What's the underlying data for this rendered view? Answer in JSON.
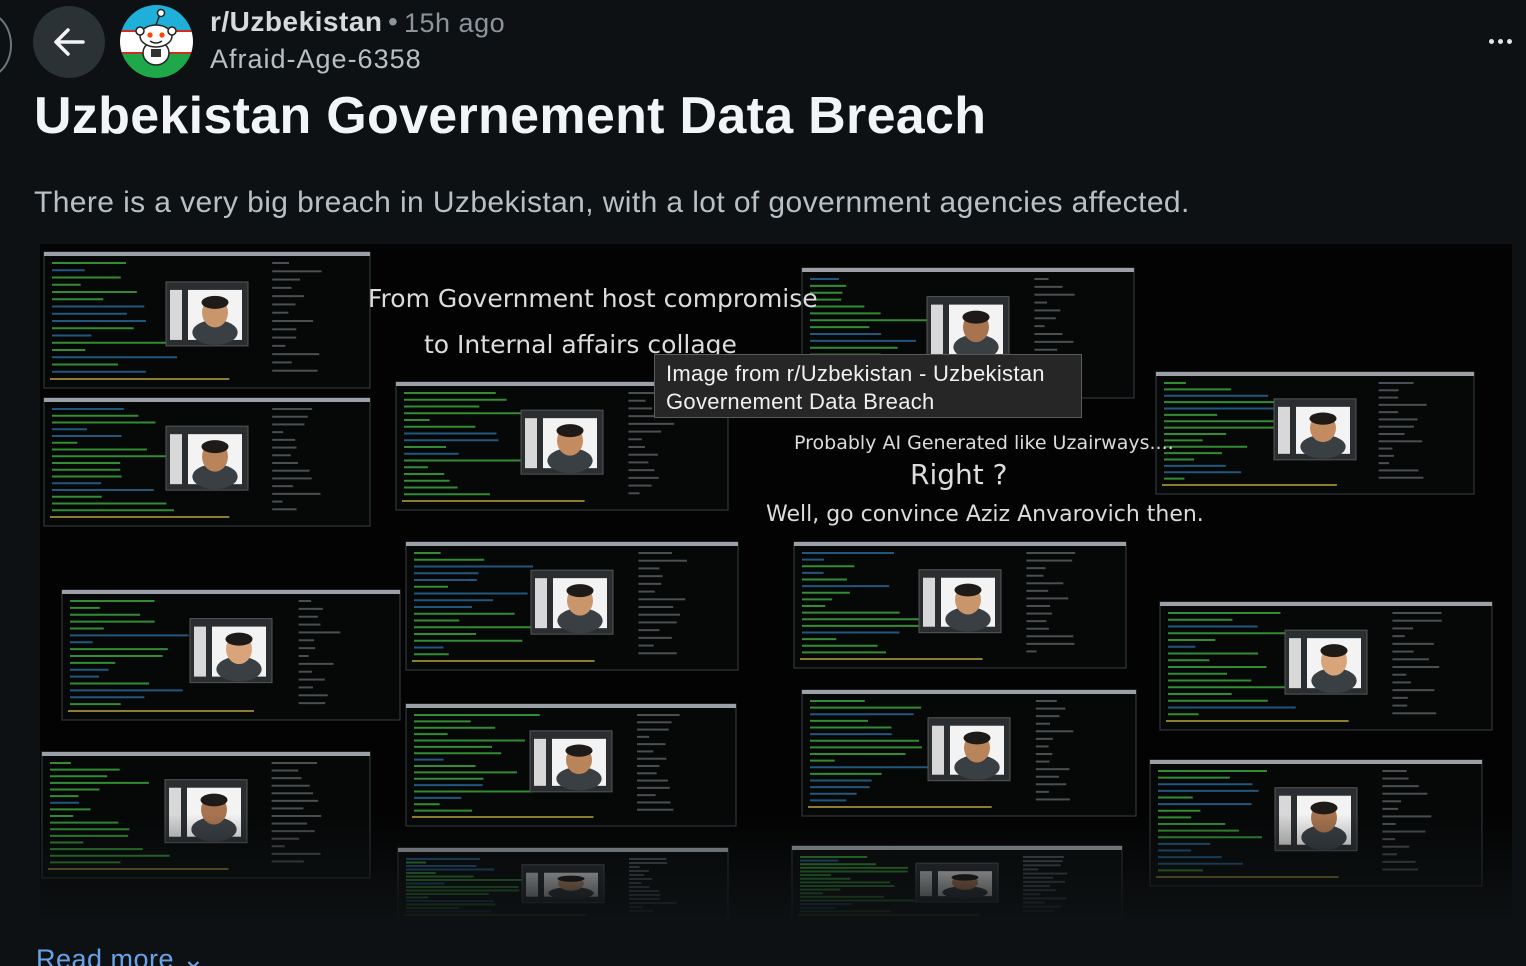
{
  "post": {
    "subreddit": "r/Uzbekistan",
    "separator": "•",
    "time_ago": "15h ago",
    "author": "Afraid-Age-6358",
    "title": "Uzbekistan Governement Data Breach",
    "body": "There is a very big breach in Uzbekistan, with a lot of government agencies affected.",
    "read_more": "Read more ⌄"
  },
  "icons": {
    "back": "arrow-left-icon",
    "more": "more-options-icon",
    "avatar": "subreddit-avatar"
  },
  "image": {
    "captions": {
      "line1": "From Government host compromise",
      "line2": "to Internal affairs collage",
      "line3": "Probably AI Generated like Uzairways....",
      "line4": "Right ?",
      "line5": "Well, go convince Aziz Anvarovich then."
    },
    "tooltip": {
      "line1": "Image from r/Uzbekistan - Uzbekistan",
      "line2": "Governement Data Breach"
    }
  },
  "colors": {
    "background": "#0e1113",
    "link": "#6aa2e8",
    "terminal_green": "#3fae3f",
    "flag_blue": "#1eb0d8",
    "flag_green": "#1fa849"
  }
}
